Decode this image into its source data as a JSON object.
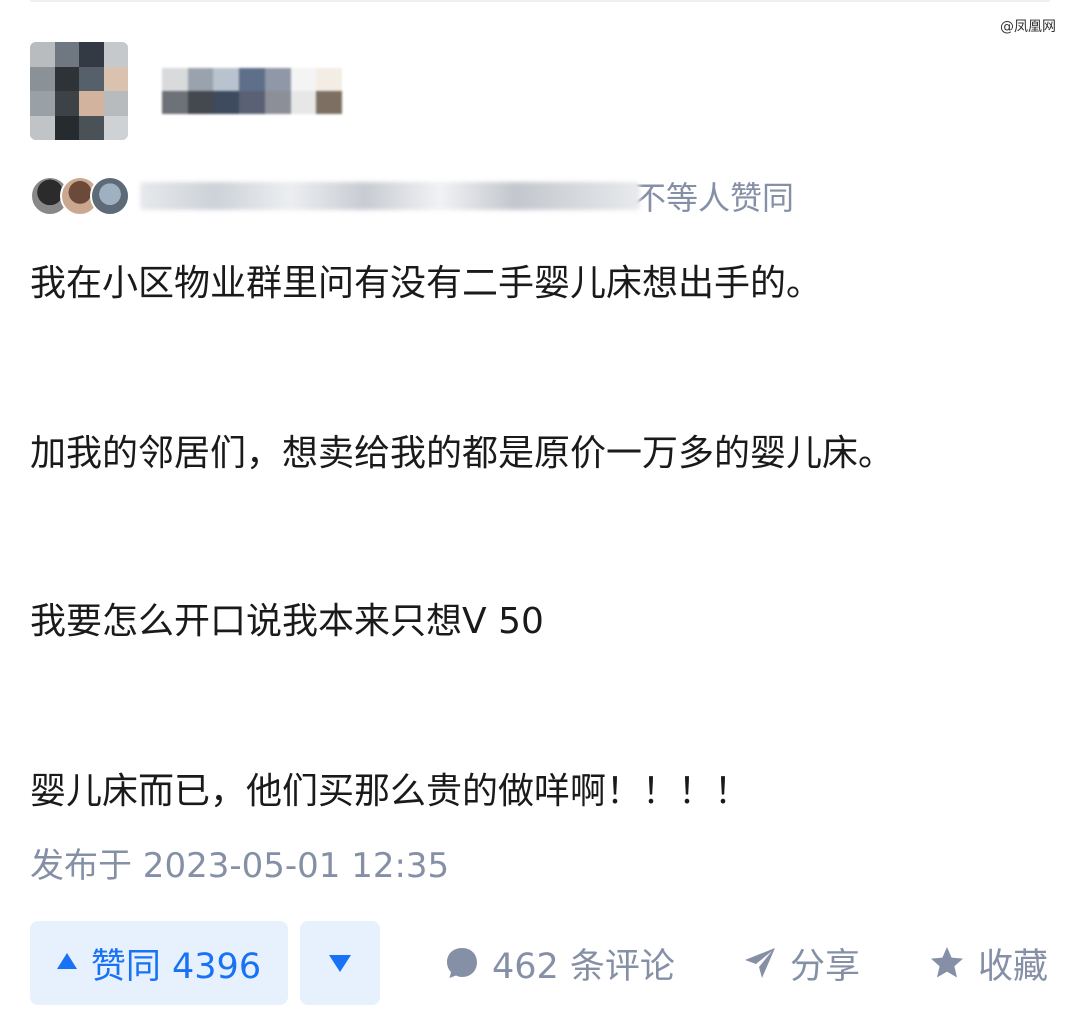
{
  "watermark": "@凤凰网",
  "author": {
    "avatar_icon": "user-avatar-pixelated",
    "name_blurred": true
  },
  "endorsement": {
    "text": "不等人赞同"
  },
  "post": {
    "paragraphs": [
      "我在小区物业群里问有没有二手婴儿床想出手的。",
      "加我的邻居们，想卖给我的都是原价一万多的婴儿床。",
      "我要怎么开口说我本来只想V 50",
      "婴儿床而已，他们买那么贵的做咩啊！！！！"
    ],
    "publish_time": "发布于 2023-05-01 12:35"
  },
  "actions": {
    "vote_up_label": "赞同 4396",
    "vote_down_icon": "triangle-down-icon",
    "comment_label": "462 条评论",
    "share_label": "分享",
    "collect_label": "收藏"
  },
  "colors": {
    "accent": "#1772f6",
    "accent_bg": "#e7f1fe",
    "muted": "#8590a6",
    "text": "#1a1a1a"
  }
}
